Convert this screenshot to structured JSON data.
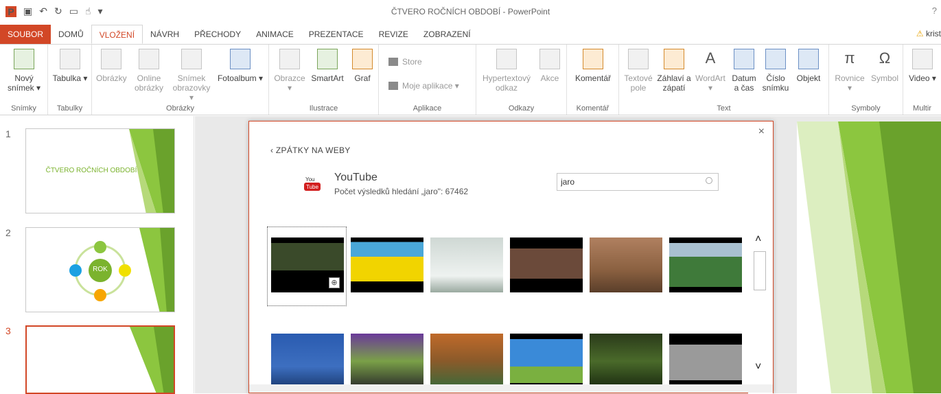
{
  "titlebar": {
    "title": "ČTVERO ROČNÍCH OBDOBÍ - PowerPoint",
    "help": "?",
    "app_icon": "P"
  },
  "tabs": [
    "SOUBOR",
    "DOMŮ",
    "VLOŽENÍ",
    "NÁVRH",
    "PŘECHODY",
    "ANIMACE",
    "PREZENTACE",
    "REVIZE",
    "ZOBRAZENÍ"
  ],
  "active_tab": "VLOŽENÍ",
  "user": {
    "name": "krist",
    "warn_icon": "⚠"
  },
  "ribbon": {
    "groups": {
      "snimky": "Snímky",
      "tabulky": "Tabulky",
      "obrazky": "Obrázky",
      "ilustrace": "Ilustrace",
      "aplikace": "Aplikace",
      "odkazy": "Odkazy",
      "komentar": "Komentář",
      "text": "Text",
      "symboly": "Symboly",
      "multimedia": "Multir"
    },
    "buttons": {
      "novy_snimek": "Nový snímek ▾",
      "tabulka": "Tabulka ▾",
      "obrazky": "Obrázky",
      "online_obrazky": "Online obrázky",
      "snimek_obrazovky": "Snímek obrazovky ▾",
      "fotoalbum": "Fotoalbum ▾",
      "obrazce": "Obrazce ▾",
      "smartart": "SmartArt",
      "graf": "Graf",
      "store": "Store",
      "moje_aplikace": "Moje aplikace ▾",
      "hypertextovy": "Hypertextový odkaz",
      "akce": "Akce",
      "komentar": "Komentář",
      "textove_pole": "Textové pole",
      "zahlavi": "Záhlaví a zápatí",
      "wordart": "WordArt ▾",
      "datum": "Datum a čas",
      "cislo": "Číslo snímku",
      "objekt": "Objekt",
      "rovnice": "Rovnice ▾",
      "symbol": "Symbol",
      "video": "Video ▾"
    }
  },
  "thumbnails": [
    {
      "num": "1",
      "title": "ČTVERO ROČNÍCH OBDOBÍ"
    },
    {
      "num": "2",
      "center": "ROK"
    },
    {
      "num": "3"
    }
  ],
  "dialog": {
    "back": "‹ ZPÁTKY NA WEBY",
    "provider": "YouTube",
    "result_count": "Počet výsledků hledání „jaro\": 67462",
    "search_value": "jaro",
    "close": "×",
    "zoom": "⊕"
  },
  "scroll": {
    "up": "˄",
    "down": "˅"
  }
}
